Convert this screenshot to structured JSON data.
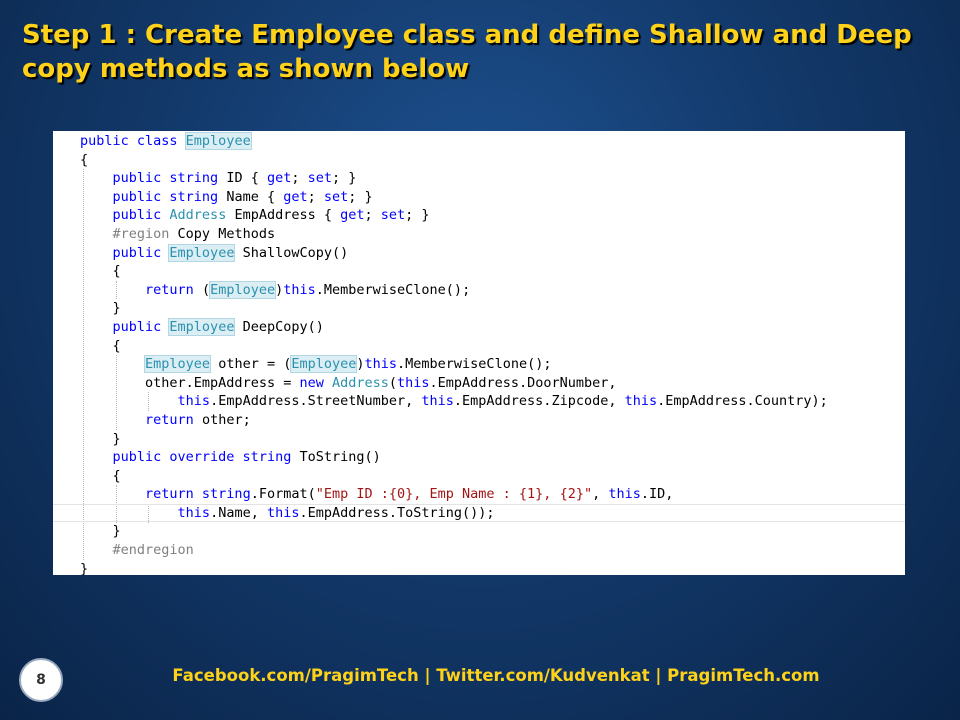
{
  "slide": {
    "title": "Step 1 : Create Employee class and define Shallow and Deep copy methods as shown below",
    "page_number": "8",
    "footer_links": [
      "Facebook.com/PragimTech",
      "Twitter.com/Kudvenkat",
      "PragimTech.com"
    ],
    "footer_separator": "  |  "
  },
  "colors": {
    "title": "#ffd21a",
    "keyword": "#0000ff",
    "type": "#2b91af",
    "string": "#a31515",
    "preprocessor": "#808080"
  },
  "code": {
    "current_line_index": 20,
    "lines": [
      {
        "indent": 0,
        "tokens": [
          [
            "kw",
            "public class "
          ],
          [
            "hl",
            "Employee"
          ]
        ]
      },
      {
        "indent": 0,
        "tokens": [
          [
            "txt",
            "{"
          ]
        ]
      },
      {
        "indent": 1,
        "tokens": [
          [
            "kw",
            "public string "
          ],
          [
            "txt",
            "ID { "
          ],
          [
            "kw",
            "get"
          ],
          [
            "txt",
            "; "
          ],
          [
            "kw",
            "set"
          ],
          [
            "txt",
            "; }"
          ]
        ]
      },
      {
        "indent": 1,
        "tokens": [
          [
            "kw",
            "public string "
          ],
          [
            "txt",
            "Name { "
          ],
          [
            "kw",
            "get"
          ],
          [
            "txt",
            "; "
          ],
          [
            "kw",
            "set"
          ],
          [
            "txt",
            "; }"
          ]
        ]
      },
      {
        "indent": 1,
        "tokens": [
          [
            "kw",
            "public "
          ],
          [
            "type",
            "Address"
          ],
          [
            "txt",
            " EmpAddress { "
          ],
          [
            "kw",
            "get"
          ],
          [
            "txt",
            "; "
          ],
          [
            "kw",
            "set"
          ],
          [
            "txt",
            "; }"
          ]
        ]
      },
      {
        "indent": 1,
        "tokens": [
          [
            "pp",
            "#region"
          ],
          [
            "txt",
            " Copy Methods"
          ]
        ]
      },
      {
        "indent": 1,
        "tokens": [
          [
            "kw",
            "public "
          ],
          [
            "hl",
            "Employee"
          ],
          [
            "txt",
            " ShallowCopy()"
          ]
        ]
      },
      {
        "indent": 1,
        "tokens": [
          [
            "txt",
            "{"
          ]
        ]
      },
      {
        "indent": 2,
        "tokens": [
          [
            "kw",
            "return "
          ],
          [
            "txt",
            "("
          ],
          [
            "hl",
            "Employee"
          ],
          [
            "txt",
            ")"
          ],
          [
            "kw",
            "this"
          ],
          [
            "txt",
            ".MemberwiseClone();"
          ]
        ]
      },
      {
        "indent": 1,
        "tokens": [
          [
            "txt",
            "}"
          ]
        ]
      },
      {
        "indent": 1,
        "tokens": [
          [
            "kw",
            "public "
          ],
          [
            "hl",
            "Employee"
          ],
          [
            "txt",
            " DeepCopy()"
          ]
        ]
      },
      {
        "indent": 1,
        "tokens": [
          [
            "txt",
            "{"
          ]
        ]
      },
      {
        "indent": 2,
        "tokens": [
          [
            "hl",
            "Employee"
          ],
          [
            "txt",
            " other = ("
          ],
          [
            "hl",
            "Employee"
          ],
          [
            "txt",
            ")"
          ],
          [
            "kw",
            "this"
          ],
          [
            "txt",
            ".MemberwiseClone();"
          ]
        ]
      },
      {
        "indent": 2,
        "tokens": [
          [
            "txt",
            "other.EmpAddress = "
          ],
          [
            "kw",
            "new "
          ],
          [
            "type",
            "Address"
          ],
          [
            "txt",
            "("
          ],
          [
            "kw",
            "this"
          ],
          [
            "txt",
            ".EmpAddress.DoorNumber,"
          ]
        ]
      },
      {
        "indent": 3,
        "tokens": [
          [
            "kw",
            "this"
          ],
          [
            "txt",
            ".EmpAddress.StreetNumber, "
          ],
          [
            "kw",
            "this"
          ],
          [
            "txt",
            ".EmpAddress.Zipcode, "
          ],
          [
            "kw",
            "this"
          ],
          [
            "txt",
            ".EmpAddress.Country);"
          ]
        ]
      },
      {
        "indent": 2,
        "tokens": [
          [
            "kw",
            "return "
          ],
          [
            "txt",
            "other;"
          ]
        ]
      },
      {
        "indent": 1,
        "tokens": [
          [
            "txt",
            "}"
          ]
        ]
      },
      {
        "indent": 1,
        "tokens": [
          [
            "kw",
            "public override string "
          ],
          [
            "txt",
            "ToString()"
          ]
        ]
      },
      {
        "indent": 1,
        "tokens": [
          [
            "txt",
            "{"
          ]
        ]
      },
      {
        "indent": 2,
        "tokens": [
          [
            "kw",
            "return string"
          ],
          [
            "txt",
            ".Format("
          ],
          [
            "str",
            "\"Emp ID :{0}, Emp Name : {1}, {2}\""
          ],
          [
            "txt",
            ", "
          ],
          [
            "kw",
            "this"
          ],
          [
            "txt",
            ".ID,"
          ]
        ]
      },
      {
        "indent": 3,
        "tokens": [
          [
            "kw",
            "this"
          ],
          [
            "txt",
            ".Name, "
          ],
          [
            "kw",
            "this"
          ],
          [
            "txt",
            ".EmpAddress.ToString());"
          ]
        ]
      },
      {
        "indent": 1,
        "tokens": [
          [
            "txt",
            "}"
          ]
        ]
      },
      {
        "indent": 1,
        "tokens": [
          [
            "pp",
            "#endregion"
          ]
        ]
      },
      {
        "indent": 0,
        "tokens": [
          [
            "txt",
            "}"
          ]
        ]
      }
    ]
  }
}
